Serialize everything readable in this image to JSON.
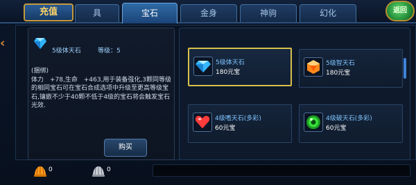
{
  "tabs": {
    "recharge": "充值",
    "items": [
      "具",
      "宝石",
      "金身",
      "神驹",
      "幻化"
    ],
    "active_index": 1,
    "back": "返回"
  },
  "detail": {
    "name": "5级体天石",
    "level_label": "等级：5",
    "description": [
      "(捆绑)",
      "体力　+78,生命　+463,用于装备强化,3颗同等级的相同宝石可在宝石合成选项中升级至更高等级宝石,镶嵌不少于40颗不低于4级的宝石将会触发宝石光效."
    ],
    "buy_label": "购买"
  },
  "shop_items": [
    {
      "name": "5级体天石",
      "price": "180元宝",
      "icon": "diamond-gem-icon",
      "color": "#36b7ff",
      "selected": true
    },
    {
      "name": "5级智天石",
      "price": "180元宝",
      "icon": "orange-gem-icon",
      "color": "#ff8a1c",
      "selected": false
    },
    {
      "name": "4级嗜天石(多彩)",
      "price": "60元宝",
      "icon": "heart-gem-icon",
      "color": "#ff3b3b",
      "selected": false
    },
    {
      "name": "4级破天石(多彩)",
      "price": "60元宝",
      "icon": "green-orb-icon",
      "color": "#37e33a",
      "selected": false
    }
  ],
  "currency": [
    {
      "icon": "gold-shell-icon",
      "value": "0"
    },
    {
      "icon": "silver-shell-icon",
      "value": "0"
    }
  ],
  "colors": {
    "accent_gold": "#d8c04a",
    "tab_active": "#2f6aa4",
    "item_name": "#7fc4ff"
  }
}
